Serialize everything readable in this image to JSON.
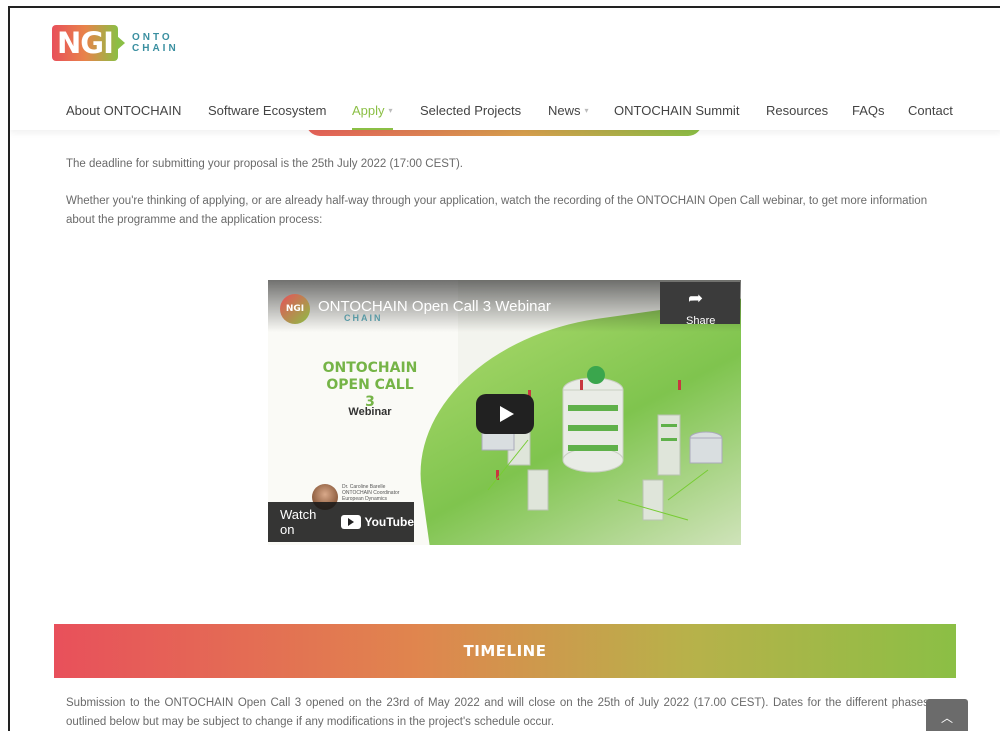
{
  "logo": {
    "ngi": "NGI",
    "line1": "ONTO",
    "line2": "CHAIN"
  },
  "nav": {
    "items": [
      {
        "label": "About ONTOCHAIN",
        "dropdown": false,
        "active": false
      },
      {
        "label": "Software Ecosystem",
        "dropdown": false,
        "active": false
      },
      {
        "label": "Apply",
        "dropdown": true,
        "active": true
      },
      {
        "label": "Selected Projects",
        "dropdown": false,
        "active": false
      },
      {
        "label": "News",
        "dropdown": true,
        "active": false
      },
      {
        "label": "ONTOCHAIN Summit",
        "dropdown": false,
        "active": false
      },
      {
        "label": "Resources",
        "dropdown": false,
        "active": false
      },
      {
        "label": "FAQs",
        "dropdown": false,
        "active": false
      },
      {
        "label": "Contact",
        "dropdown": false,
        "active": false
      }
    ],
    "caret": "▾"
  },
  "content": {
    "deadline": "The deadline for submitting your proposal is the 25th July 2022 (17:00 CEST).",
    "webinar_intro": "Whether you're thinking of applying, or are already half-way through your application, watch the recording of the ONTOCHAIN Open Call webinar, to get more information about the programme and the application process:"
  },
  "video": {
    "logo": "NGI",
    "title": "ONTOCHAIN Open Call 3 Webinar",
    "chain_label": "CHAIN",
    "share_label": "Share",
    "heading_line1": "ONTOCHAIN",
    "heading_line2": "OPEN CALL 3",
    "subheading": "Webinar",
    "presenter_name": "Dr. Caroline Barelle",
    "presenter_role": "ONTOCHAIN Coordinator",
    "presenter_org": "European Dynamics",
    "watch_on": "Watch on",
    "youtube": "YouTube"
  },
  "timeline": {
    "title": "TIMELINE",
    "text": "Submission to the ONTOCHAIN Open Call 3 opened on the 23rd of May 2022 and will close on the 25th of July 2022 (17.00 CEST). Dates for the different phases are outlined below but may be subject to change if any modifications in the project's schedule occur."
  },
  "scroll_top": {
    "icon": "chevron-up-icon",
    "glyph": "︿"
  },
  "colors": {
    "accent_green": "#8bbf45",
    "accent_red": "#e8505b",
    "text": "#6a6a6a"
  }
}
